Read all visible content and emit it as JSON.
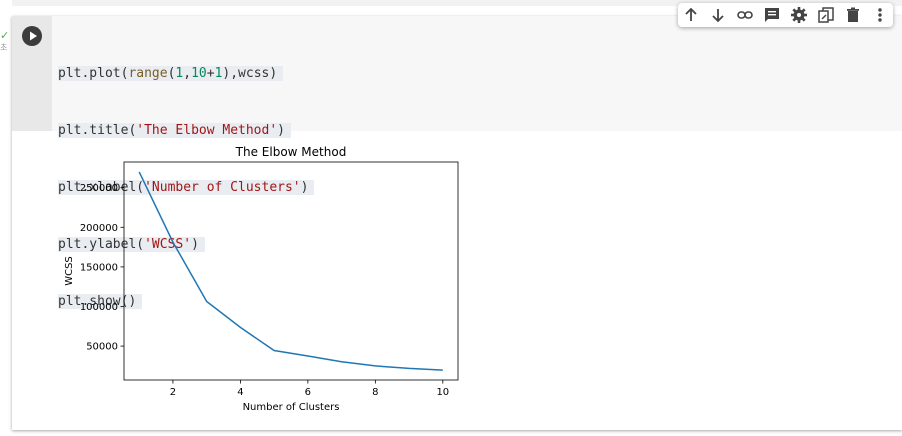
{
  "gutter": {
    "mark": "✓",
    "sub": "초"
  },
  "toolbar": {
    "icons": [
      "arrow-up-icon",
      "arrow-down-icon",
      "link-icon",
      "comment-icon",
      "gear-icon",
      "mirror-cell-icon",
      "trash-icon",
      "more-vert-icon"
    ]
  },
  "code": {
    "lines": [
      "plt.plot(range(1,10+1),wcss)",
      "plt.title('The Elbow Method')",
      "plt.xlabel('Number of Clusters')",
      "plt.ylabel('WCSS')",
      "plt.show()"
    ]
  },
  "chart_data": {
    "type": "line",
    "title": "The Elbow Method",
    "xlabel": "Number of Clusters",
    "ylabel": "WCSS",
    "x": [
      1,
      2,
      3,
      4,
      5,
      6,
      7,
      8,
      9,
      10
    ],
    "series": [
      {
        "values": [
          269981,
          181363,
          106348,
          73679,
          44449,
          37456,
          30259,
          25011,
          21850,
          19672
        ],
        "color": "#1f77b4"
      }
    ],
    "xticks": [
      2,
      4,
      6,
      8,
      10
    ],
    "yticks": [
      50000,
      100000,
      150000,
      200000,
      250000
    ],
    "xlim": [
      0.55,
      10.45
    ],
    "ylim": [
      7206,
      282447
    ],
    "grid": false,
    "legend": "none"
  },
  "colors": {
    "accent": "#1f77b4",
    "code_bg": "#f7f7f7",
    "gutter_bg": "#e8e8e8"
  }
}
